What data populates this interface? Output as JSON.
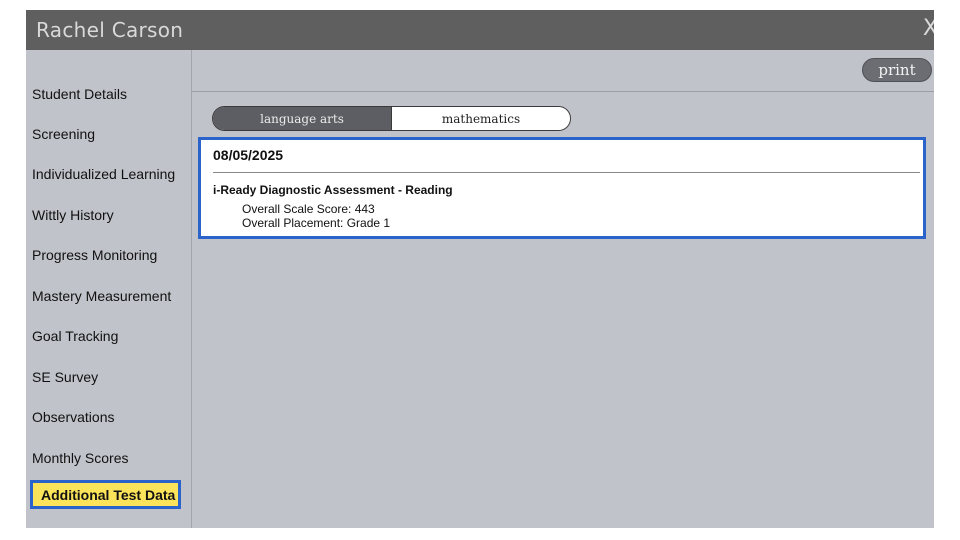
{
  "window": {
    "title": "Rachel Carson",
    "close_glyph": "X"
  },
  "sidebar": {
    "items": [
      {
        "label": "Student Details"
      },
      {
        "label": "Screening"
      },
      {
        "label": "Individualized Learning"
      },
      {
        "label": "Wittly History"
      },
      {
        "label": "Progress Monitoring"
      },
      {
        "label": "Mastery Measurement"
      },
      {
        "label": "Goal Tracking"
      },
      {
        "label": "SE Survey"
      },
      {
        "label": "Observations"
      },
      {
        "label": "Monthly Scores"
      },
      {
        "label": "Additional Test Data",
        "active": true
      }
    ]
  },
  "toolbar": {
    "print_label": "print"
  },
  "tabs": [
    {
      "label": "language arts",
      "selected": true
    },
    {
      "label": "mathematics",
      "selected": false
    }
  ],
  "result": {
    "date": "08/05/2025",
    "assessment": "i-Ready Diagnostic Assessment - Reading",
    "scale_score": "Overall Scale Score: 443",
    "placement": "Overall Placement: Grade 1"
  },
  "colors": {
    "titlebar": "#5f5f5f",
    "background": "#c1c3ca",
    "active_highlight": "#fbe35a",
    "focus_border": "#2a63c9"
  }
}
